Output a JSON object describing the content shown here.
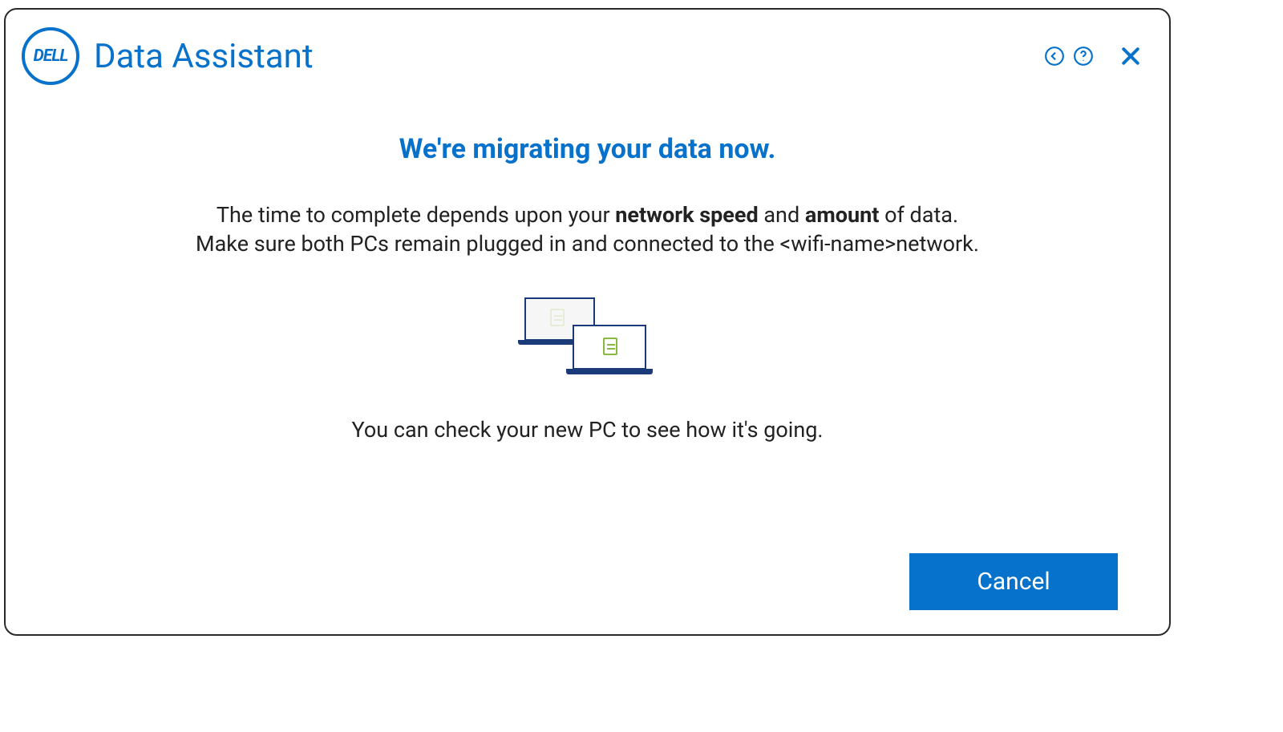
{
  "header": {
    "logo_text": "DELL",
    "app_title": "Data Assistant"
  },
  "controls": {
    "back_icon": "back-icon",
    "help_icon": "help-icon",
    "close_icon": "close-icon"
  },
  "main": {
    "headline": "We're migrating your data now.",
    "line1_pre": "The time to complete depends upon your ",
    "line1_bold1": "network speed",
    "line1_mid": " and ",
    "line1_bold2": "amount",
    "line1_post": " of data.",
    "line2_pre": "Make sure both PCs remain plugged in and connected to the ",
    "line2_placeholder": "<wifi-name>",
    "line2_post": "network.",
    "sub_text": "You can check your new PC to see how it's going."
  },
  "footer": {
    "cancel_label": "Cancel"
  },
  "colors": {
    "brand": "#0672cb",
    "text": "#222222"
  }
}
